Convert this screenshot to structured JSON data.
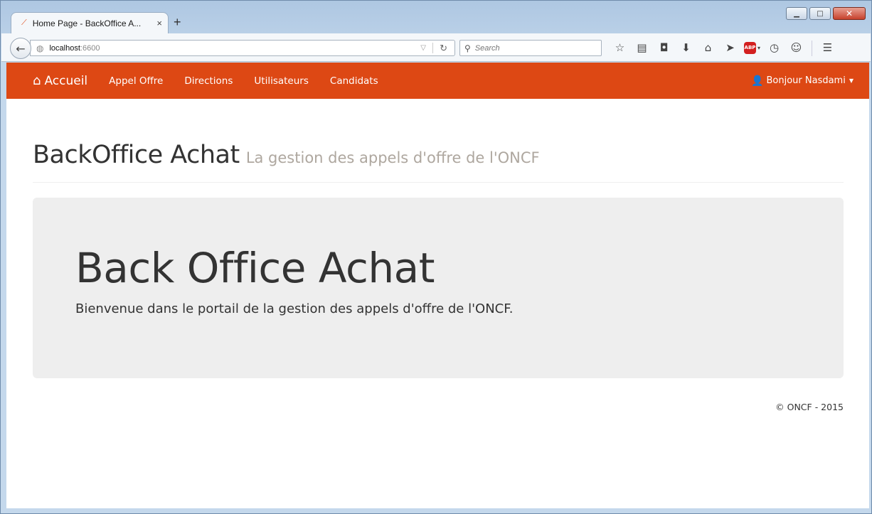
{
  "browser": {
    "tab": {
      "title": "Home Page - BackOffice A...",
      "close": "×"
    },
    "new_tab": "+",
    "url": {
      "host": "localhost",
      "port": ":6600"
    },
    "search": {
      "placeholder": "Search"
    },
    "caption": {
      "minimize": "▁",
      "maximize": "□",
      "close": "✕"
    }
  },
  "navbar": {
    "brand": "Accueil",
    "items": [
      {
        "label": "Appel Offre"
      },
      {
        "label": "Directions"
      },
      {
        "label": "Utilisateurs"
      },
      {
        "label": "Candidats"
      }
    ],
    "user": "Bonjour Nasdami"
  },
  "header": {
    "title": "BackOffice Achat",
    "subtitle": "La gestion des appels d'offre de l'ONCF"
  },
  "jumbotron": {
    "title": "Back Office Achat",
    "text": "Bienvenue dans le portail de la gestion des appels d'offre de l'ONCF."
  },
  "footer": {
    "text": "© ONCF - 2015"
  },
  "colors": {
    "navbar": "#dd4814",
    "jumbotron": "#eeeeee",
    "subtitle": "#aea79f"
  }
}
